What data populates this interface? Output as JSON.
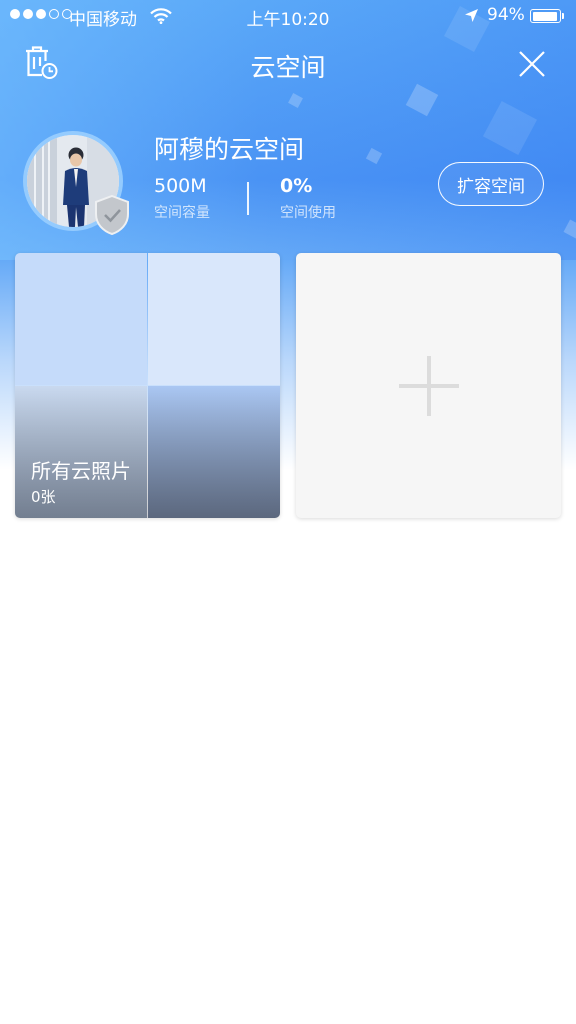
{
  "status_bar": {
    "carrier": "中国移动",
    "time": "上午10:20",
    "battery": "94%",
    "battery_level": 0.94
  },
  "nav": {
    "title": "云空间",
    "left_icon": "trash-clock-icon",
    "right_icon": "close-icon"
  },
  "profile": {
    "name": "阿穆的云空间",
    "capacity_value": "500M",
    "capacity_label": "空间容量",
    "usage_value": "0%",
    "usage_label": "空间使用",
    "expand_button": "扩容空间"
  },
  "albums": [
    {
      "title": "所有云照片",
      "count": "0张"
    }
  ],
  "add_card_icon": "plus-icon",
  "colors": {
    "header_blue": "#4a93f4",
    "accent_white": "#ffffff"
  }
}
